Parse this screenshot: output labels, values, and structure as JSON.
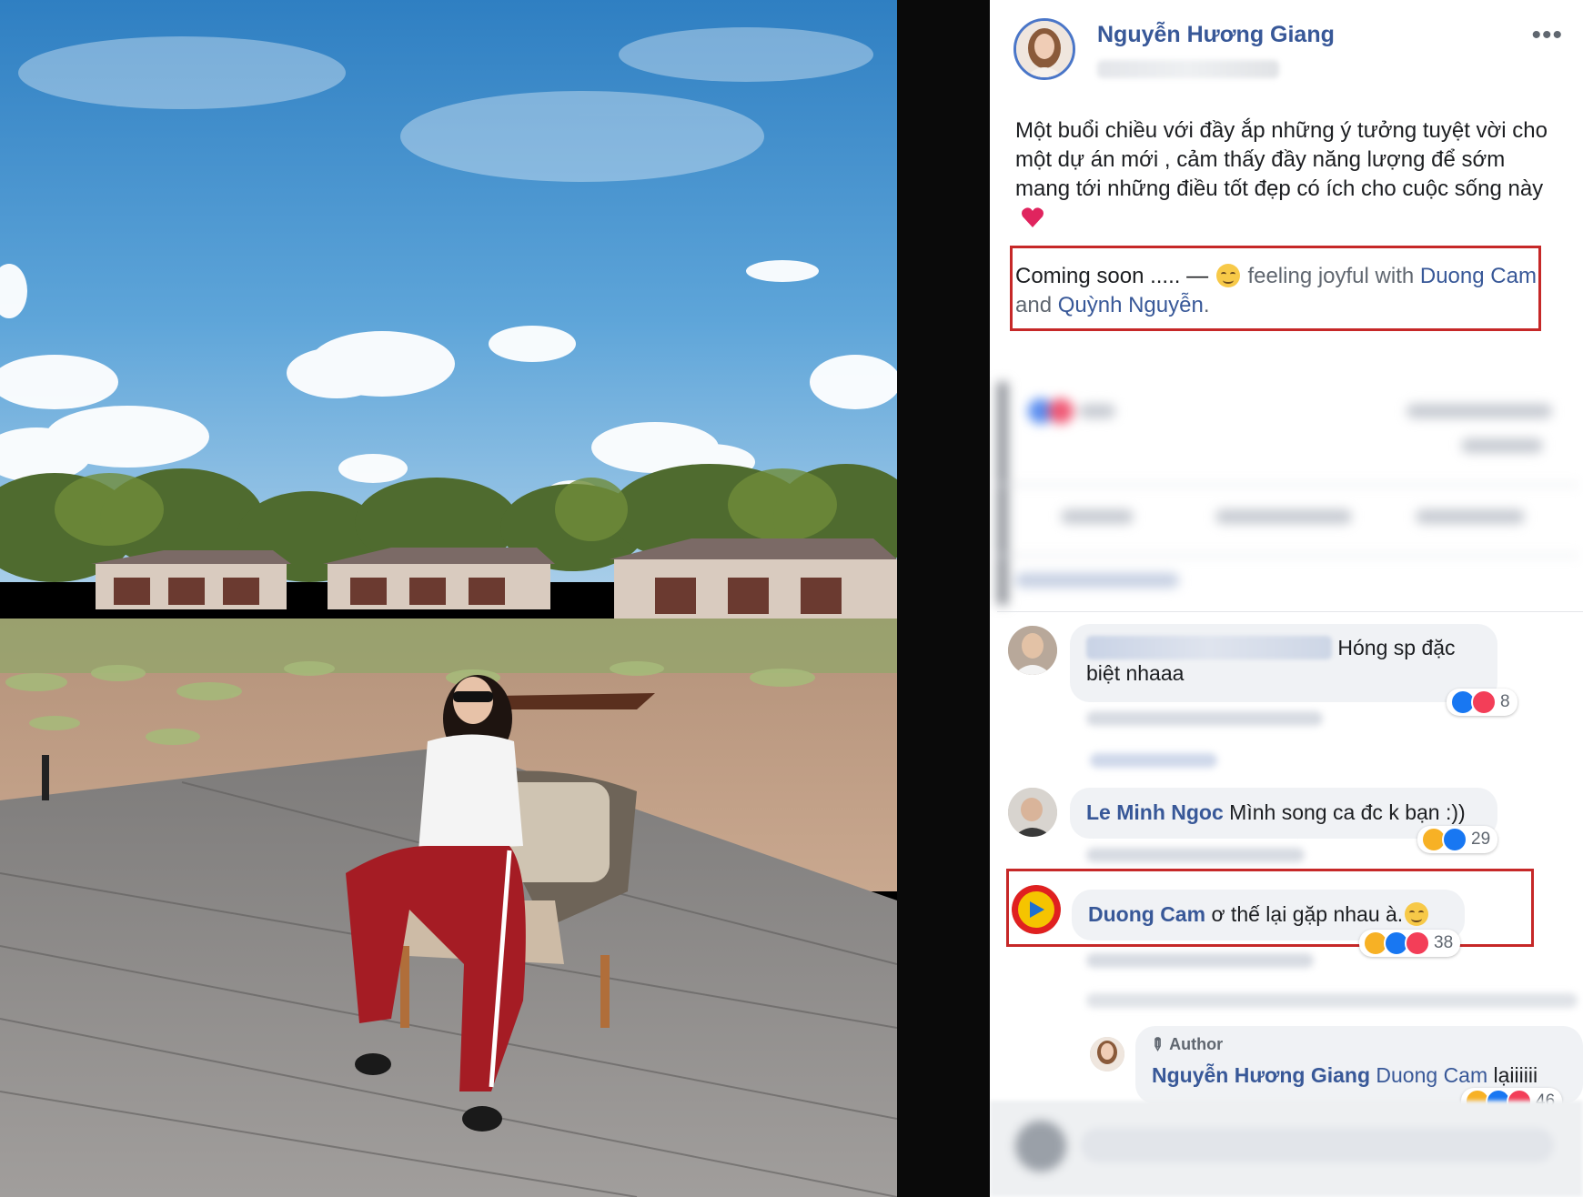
{
  "post": {
    "author": "Nguyễn Hương Giang",
    "more_icon": "•••",
    "text": "Một buổi chiều với đầy ắp những ý tưởng tuyệt vời cho một dự án mới , cảm thấy đầy năng lượng để sớm mang tới những điều tốt đẹp có ích cho cuộc sống này",
    "tagline": {
      "lead": "Coming soon ..... — ",
      "feeling": "feeling joyful with ",
      "friend1": "Duong Cam",
      "and": " and ",
      "friend2": "Quỳnh Nguyễn",
      "end": "."
    }
  },
  "comments": [
    {
      "name": "",
      "text": "Hóng sp đặc biệt nhaaa",
      "reaction_count": "8",
      "reactions": [
        "like-icon",
        "love-icon"
      ]
    },
    {
      "name": "Le Minh Ngoc",
      "text": "Mình song ca đc k bạn :))",
      "reaction_count": "29",
      "reactions": [
        "haha-icon",
        "like-icon"
      ]
    },
    {
      "name": "Duong Cam",
      "text": "ơ thế lại gặp nhau à.",
      "reaction_count": "38",
      "reactions": [
        "haha-icon",
        "like-icon",
        "love-icon"
      ]
    }
  ],
  "reply": {
    "badge": "Author",
    "name": "Nguyễn Hương Giang",
    "mention": "Duong Cam",
    "text": "lạiiiiii",
    "reaction_count": "46"
  },
  "colors": {
    "link": "#385898",
    "highlight": "#c62828",
    "bubble": "#f0f2f5"
  }
}
